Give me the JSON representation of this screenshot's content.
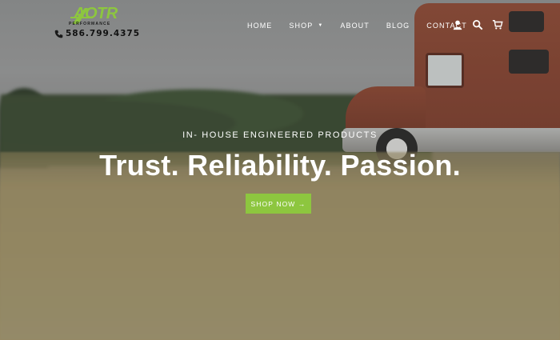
{
  "brand": {
    "logo_text": "AOTR",
    "logo_subtext": "PERFORMANCE",
    "phone": "586.799.4375",
    "accent_color": "#8dc63f"
  },
  "nav": {
    "items": [
      {
        "label": "HOME"
      },
      {
        "label": "SHOP"
      },
      {
        "label": "ABOUT"
      },
      {
        "label": "BLOG"
      },
      {
        "label": "CONTACT"
      }
    ],
    "icons": [
      "account-icon",
      "search-icon",
      "cart-icon"
    ]
  },
  "hero": {
    "eyebrow": "IN- HOUSE ENGINEERED PRODUCTS",
    "headline": "Trust. Reliability. Passion.",
    "cta_label": "SHOP NOW →"
  }
}
